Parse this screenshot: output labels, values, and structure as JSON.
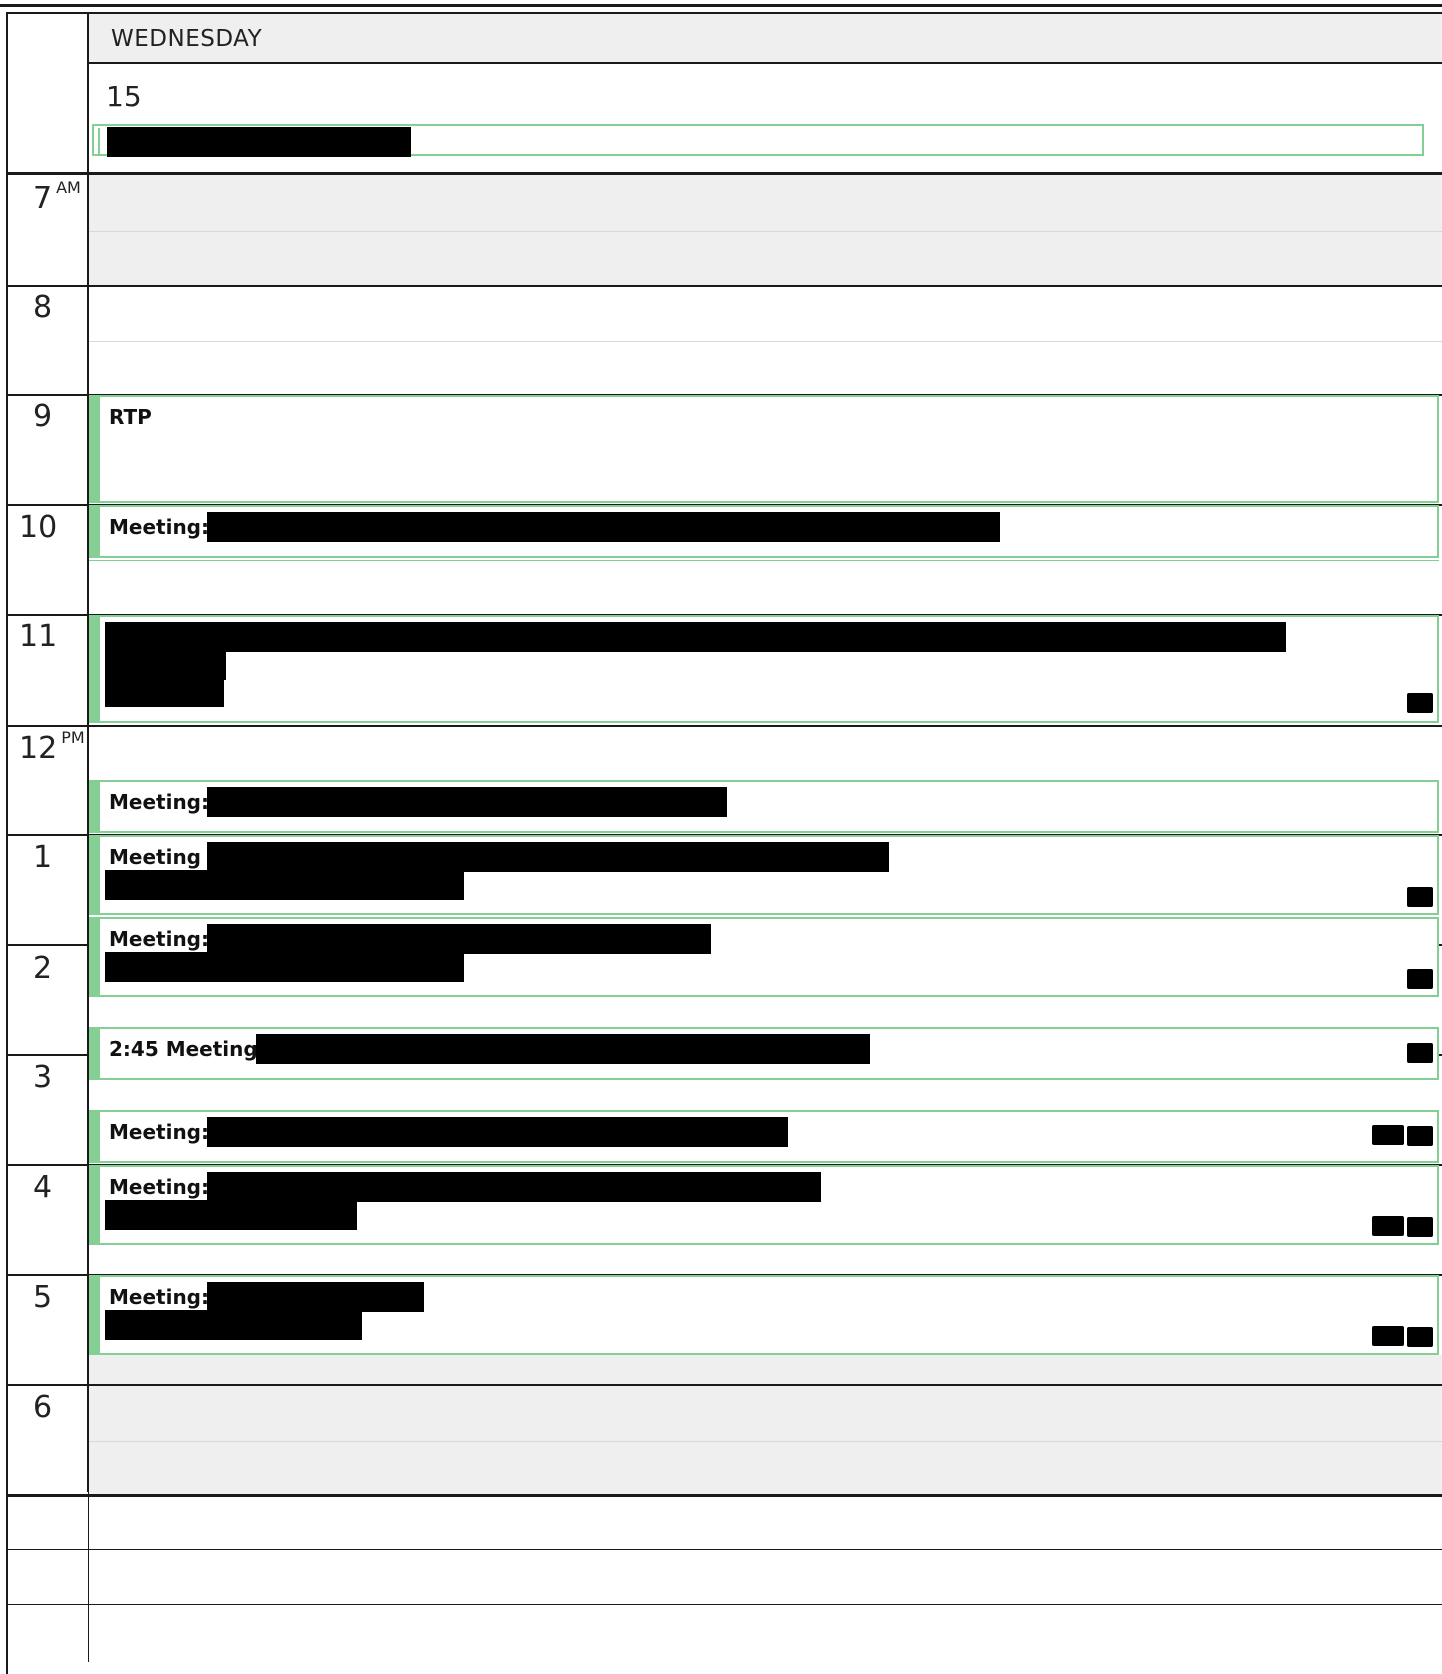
{
  "day": {
    "name": "WEDNESDAY",
    "date": "15"
  },
  "hours": [
    {
      "label": "7",
      "suffix": "AM"
    },
    {
      "label": "8",
      "suffix": ""
    },
    {
      "label": "9",
      "suffix": ""
    },
    {
      "label": "10",
      "suffix": ""
    },
    {
      "label": "11",
      "suffix": ""
    },
    {
      "label": "12",
      "suffix": "PM"
    },
    {
      "label": "1",
      "suffix": ""
    },
    {
      "label": "2",
      "suffix": ""
    },
    {
      "label": "3",
      "suffix": ""
    },
    {
      "label": "4",
      "suffix": ""
    },
    {
      "label": "5",
      "suffix": ""
    },
    {
      "label": "6",
      "suffix": ""
    }
  ],
  "events": [
    {
      "title": "RTP"
    },
    {
      "title": "Meeting:"
    },
    {
      "title": ""
    },
    {
      "title": "Meeting:"
    },
    {
      "title": "Meeting :"
    },
    {
      "title": "Meeting:"
    },
    {
      "title": "2:45 Meeting:"
    },
    {
      "title": "Meeting:"
    },
    {
      "title": "Meeting:"
    },
    {
      "title": "Meeting:"
    }
  ],
  "colors": {
    "event_border": "#85cf94",
    "offhours_band": "#efefef",
    "grid_line": "#1a1a1a"
  }
}
